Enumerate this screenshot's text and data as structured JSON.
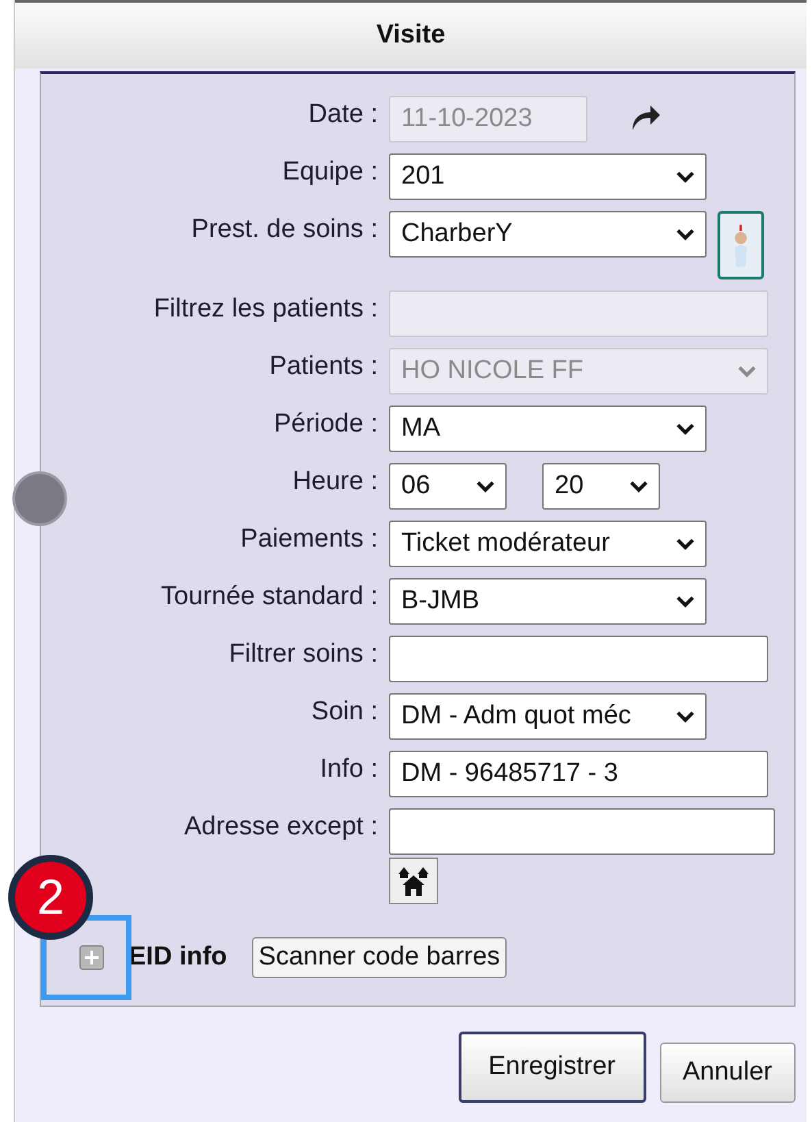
{
  "window": {
    "title": "Visite"
  },
  "fields": [
    {
      "label": "Date :",
      "kind": "date",
      "value": "11-10-2023",
      "disabled": true
    },
    {
      "label": "Equipe :",
      "kind": "select",
      "value": "201",
      "disabled": false
    },
    {
      "label": "Prest. de soins :",
      "kind": "provider-select",
      "value": "CharberY",
      "disabled": false
    },
    {
      "label": "Filtrez les patients :",
      "kind": "input",
      "disabled": true
    },
    {
      "label": "Patients :",
      "kind": "wide-select",
      "value": "HO NICOLE FF",
      "disabled": true
    },
    {
      "label": "Période :",
      "kind": "select",
      "value": "MA",
      "disabled": false
    },
    {
      "label": "Heure :",
      "kind": "time",
      "value": "06",
      "value2": "20",
      "disabled": false
    },
    {
      "label": "Paiements :",
      "kind": "select",
      "value": "Ticket modérateur",
      "disabled": false
    },
    {
      "label": "Tournée standard :",
      "kind": "select",
      "value": "B-JMB",
      "disabled": false
    },
    {
      "label": "Filtrer soins :",
      "kind": "input",
      "disabled": false
    },
    {
      "label": "Soin :",
      "kind": "select",
      "value": "DM - Adm quot méc",
      "disabled": false
    },
    {
      "label": "Info :",
      "kind": "input",
      "value": "DM - 96485717 - 3",
      "disabled": false
    },
    {
      "label": "Adresse except :",
      "kind": "address",
      "disabled": false
    }
  ],
  "eid": {
    "label": "EID info",
    "expanded": false,
    "button": "Scanner code barres"
  },
  "annotation": {
    "badge": "2"
  },
  "buttons": [
    {
      "label": "Enregistrer",
      "default": true
    },
    {
      "label": "Annuler",
      "default": false
    }
  ]
}
